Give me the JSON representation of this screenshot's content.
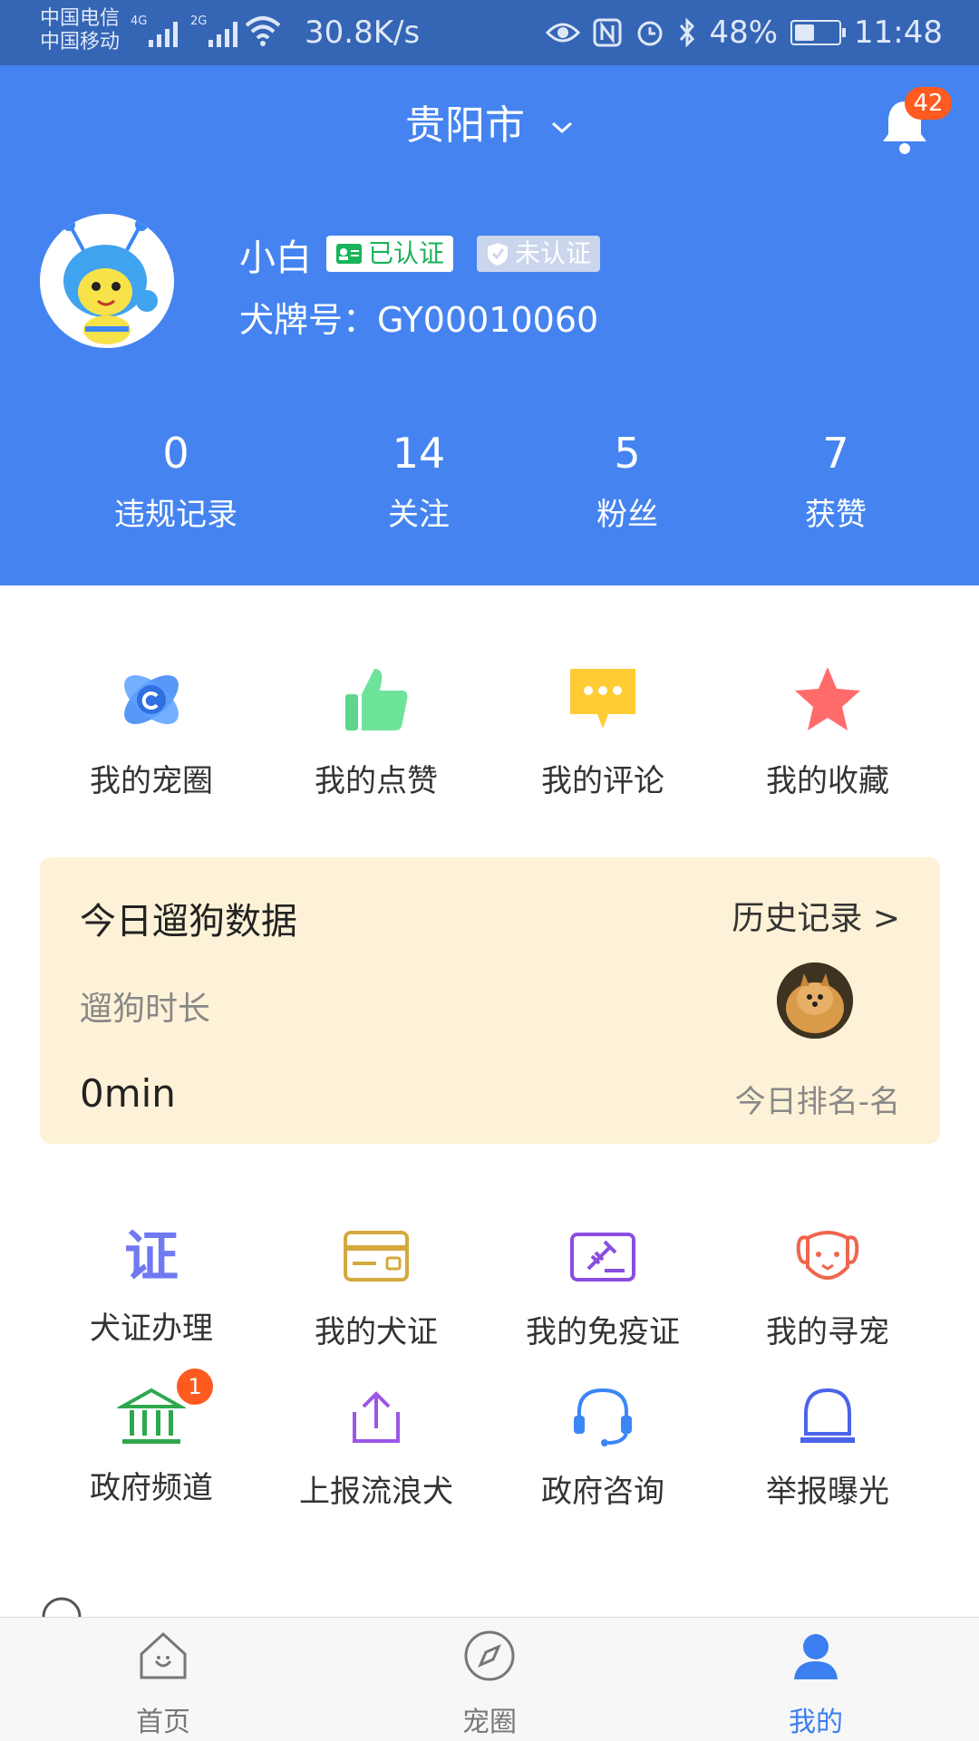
{
  "status_bar": {
    "carrier_1": "中国电信",
    "carrier_2": "中国移动",
    "net_1": "4G",
    "net_2": "2G",
    "speed": "30.8K/s",
    "battery": "48%",
    "battery_level": 0.48,
    "time": "11:48"
  },
  "header": {
    "city": "贵阳市",
    "notification_count": "42",
    "username": "小白",
    "verified_label": "已认证",
    "unverified_label": "未认证",
    "dog_tag": "犬牌号：GY00010060",
    "stats": [
      {
        "value": "0",
        "label": "违规记录"
      },
      {
        "value": "14",
        "label": "关注"
      },
      {
        "value": "5",
        "label": "粉丝"
      },
      {
        "value": "7",
        "label": "获赞"
      }
    ]
  },
  "quick_actions": [
    {
      "label": "我的宠圈",
      "icon": "planet-icon",
      "color": "#3a86f5"
    },
    {
      "label": "我的点赞",
      "icon": "thumbs-up-icon",
      "color": "#5fd68f"
    },
    {
      "label": "我的评论",
      "icon": "comment-icon",
      "color": "#ffcc33"
    },
    {
      "label": "我的收藏",
      "icon": "star-icon",
      "color": "#ff6b6b"
    }
  ],
  "walk_card": {
    "title": "今日遛狗数据",
    "history_link": "历史记录 >",
    "duration_label": "遛狗时长",
    "duration_value": "0min",
    "rank": "今日排名-名"
  },
  "services": [
    {
      "label": "犬证办理",
      "icon": "certificate-icon",
      "glyph": "证",
      "color": "#6f79f2"
    },
    {
      "label": "我的犬证",
      "icon": "id-card-icon",
      "color": "#d4a93d"
    },
    {
      "label": "我的免疫证",
      "icon": "vaccine-icon",
      "color": "#8a4de0"
    },
    {
      "label": "我的寻宠",
      "icon": "dog-face-icon",
      "color": "#f0654e"
    },
    {
      "label": "政府频道",
      "icon": "government-building-icon",
      "color": "#2ea84e",
      "badge": "1"
    },
    {
      "label": "上报流浪犬",
      "icon": "upload-icon",
      "color": "#9b56e6"
    },
    {
      "label": "政府咨询",
      "icon": "headset-icon",
      "color": "#3a86f5"
    },
    {
      "label": "举报曝光",
      "icon": "alarm-light-icon",
      "color": "#4b63e8"
    }
  ],
  "tabbar": {
    "tabs": [
      {
        "label": "首页",
        "icon": "home-icon"
      },
      {
        "label": "宠圈",
        "icon": "compass-icon"
      },
      {
        "label": "我的",
        "icon": "user-icon",
        "active": true
      }
    ],
    "accent": "#3b7ff0"
  }
}
